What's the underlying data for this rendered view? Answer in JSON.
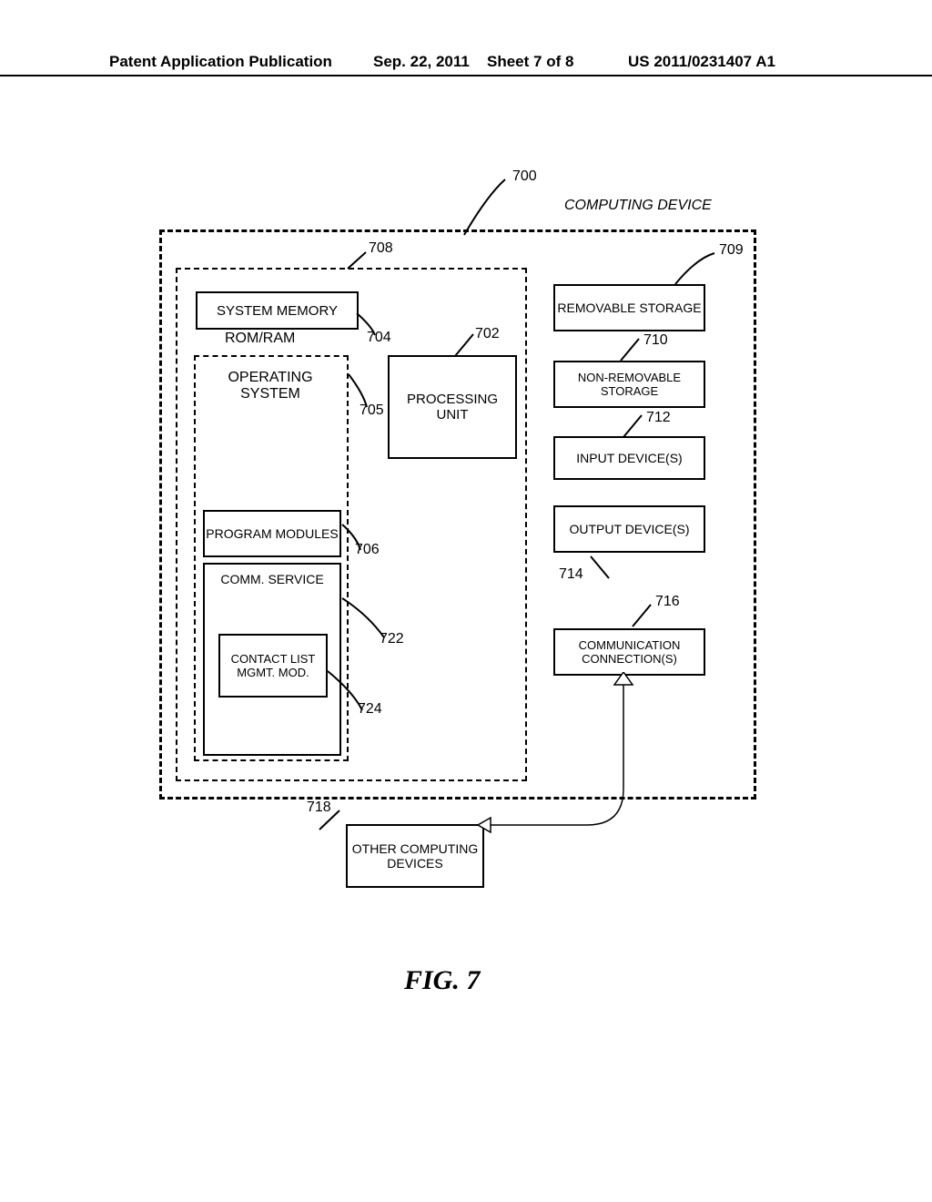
{
  "header": {
    "title": "Patent Application Publication",
    "date": "Sep. 22, 2011",
    "sheet": "Sheet 7 of 8",
    "number": "US 2011/0231407 A1"
  },
  "labels": {
    "l700": "700",
    "device_title": "COMPUTING DEVICE",
    "l708": "708",
    "l709": "709",
    "sys_mem": "SYSTEM MEMORY",
    "rom_ram": "ROM/RAM",
    "l704": "704",
    "l702": "702",
    "removable": "REMOVABLE STORAGE",
    "l710": "710",
    "os": "OPERATING SYSTEM",
    "l705": "705",
    "proc": "PROCESSING UNIT",
    "nonremovable": "NON-REMOVABLE STORAGE",
    "l712": "712",
    "input": "INPUT DEVICE(S)",
    "prog_mod": "PROGRAM MODULES",
    "l706": "706",
    "output": "OUTPUT DEVICE(S)",
    "l714": "714",
    "comm_svc": "COMM. SERVICE",
    "l722": "722",
    "l716": "716",
    "contact": "CONTACT LIST MGMT. MOD.",
    "comm_conn": "COMMUNICATION CONNECTION(S)",
    "l724": "724",
    "l718": "718",
    "other": "OTHER COMPUTING DEVICES",
    "fig": "FIG. 7"
  }
}
